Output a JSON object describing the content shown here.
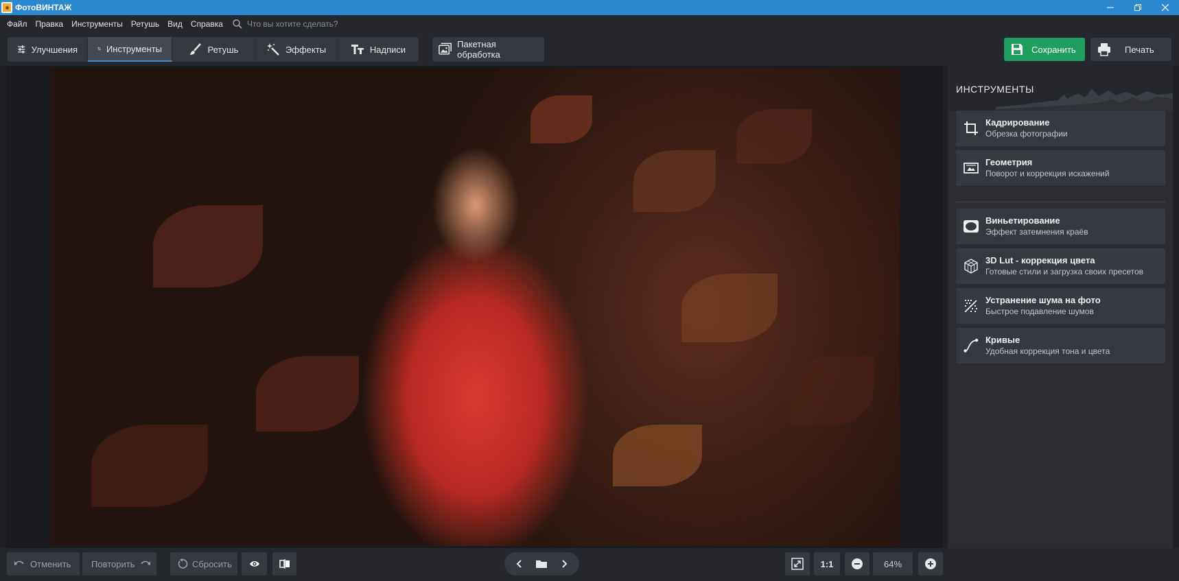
{
  "window": {
    "title": "ФотоВИНТАЖ"
  },
  "menu": {
    "items": [
      "Файл",
      "Правка",
      "Инструменты",
      "Ретушь",
      "Вид",
      "Справка"
    ],
    "search_placeholder": "Что вы хотите сделать?"
  },
  "toolbar": {
    "tabs": [
      {
        "label": "Улучшения",
        "icon": "sliders-icon",
        "active": false
      },
      {
        "label": "Инструменты",
        "icon": "crop-icon",
        "active": true
      },
      {
        "label": "Ретушь",
        "icon": "brush-icon",
        "active": false
      },
      {
        "label": "Эффекты",
        "icon": "magic-wand-icon",
        "active": false
      },
      {
        "label": "Надписи",
        "icon": "text-icon",
        "active": false
      }
    ],
    "batch_label": "Пакетная обработка",
    "save_label": "Сохранить",
    "print_label": "Печать",
    "save_color": "#1f9e5f"
  },
  "bottom": {
    "undo_label": "Отменить",
    "redo_label": "Повторить",
    "reset_label": "Сбросить",
    "zoom_one_to_one": "1:1",
    "zoom_percent": "64%"
  },
  "panel": {
    "title": "ИНСТРУМЕНТЫ",
    "tools": [
      {
        "title": "Кадрирование",
        "desc": "Обрезка фотографии",
        "icon": "crop-icon"
      },
      {
        "title": "Геометрия",
        "desc": "Поворот и коррекция искажений",
        "icon": "geometry-icon"
      },
      {
        "title": "Виньетирование",
        "desc": "Эффект затемнения краёв",
        "icon": "vignette-icon"
      },
      {
        "title": "3D Lut - коррекция цвета",
        "desc": "Готовые стили и загрузка своих пресетов",
        "icon": "lut-cube-icon"
      },
      {
        "title": "Устранение шума на фото",
        "desc": "Быстрое подавление шумов",
        "icon": "noise-icon"
      },
      {
        "title": "Кривые",
        "desc": "Удобная коррекция тона и цвета",
        "icon": "curves-icon"
      }
    ]
  }
}
